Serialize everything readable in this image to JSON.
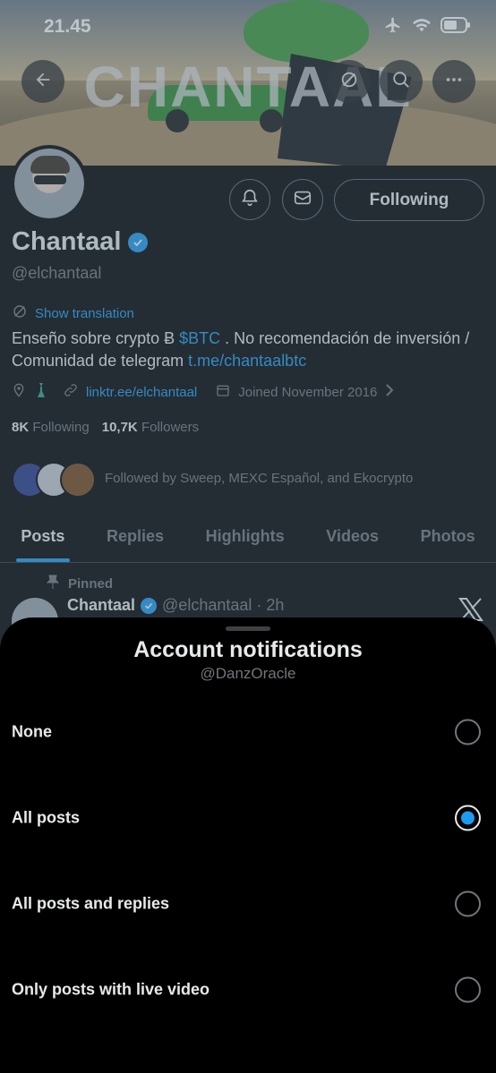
{
  "status": {
    "time": "21.45"
  },
  "banner": {
    "title": "CHANTAAL"
  },
  "profile": {
    "following_button": "Following",
    "name": "Chantaal",
    "handle": "@elchantaal",
    "translate": "Show translation",
    "bio_part1": "Enseño sobre crypto Ƀ ",
    "bio_link1": "$BTC",
    "bio_part2": " . No recomendación de inversión / Comunidad de telegram ",
    "bio_link2": "t.me/chantaalbtc",
    "website": "linktr.ee/elchantaal",
    "joined": "Joined November 2016",
    "following_count": "8K",
    "following_label": "Following",
    "followers_count": "10,7K",
    "followers_label": "Followers",
    "followed_by": "Followed by Sweep, MEXC Español, and Ekocrypto"
  },
  "tabs": [
    "Posts",
    "Replies",
    "Highlights",
    "Videos",
    "Photos"
  ],
  "pinned_post": {
    "pinned_label": "Pinned",
    "name": "Chantaal",
    "meta": "@elchantaal · 2h"
  },
  "sheet": {
    "title": "Account notifications",
    "subtitle": "@DanzOracle",
    "options": [
      {
        "label": "None",
        "selected": false
      },
      {
        "label": "All posts",
        "selected": true
      },
      {
        "label": "All posts and replies",
        "selected": false
      },
      {
        "label": "Only posts with live video",
        "selected": false
      }
    ]
  },
  "colors": {
    "accent": "#1d9bf0",
    "background": "#000000",
    "muted": "#71767b"
  }
}
